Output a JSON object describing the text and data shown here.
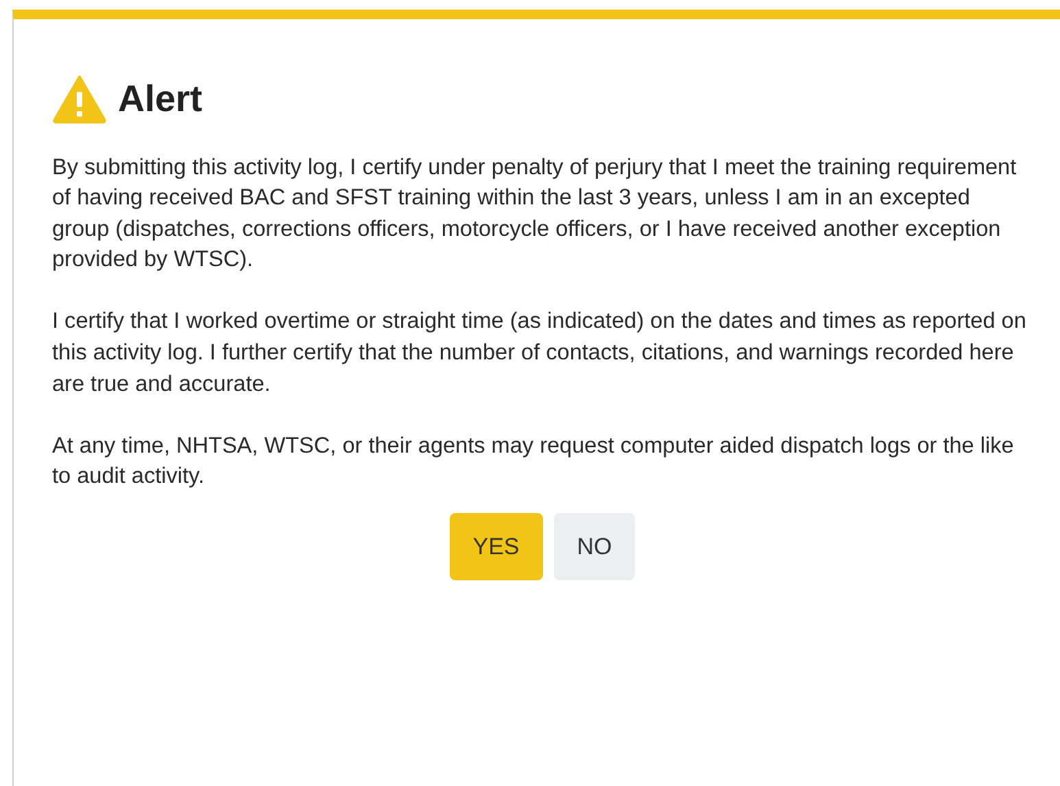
{
  "dialog": {
    "title": "Alert",
    "paragraphs": [
      "By submitting this activity log, I certify under penalty of perjury that I meet the training requirement of having received BAC and SFST training within the last 3 years, unless I am in an excepted group (dispatches, corrections officers, motorcycle officers, or I have received another exception provided by WTSC).",
      "I certify that I worked overtime or straight time (as indicated) on the dates and times as reported on this activity log. I further certify that the number of contacts, citations, and warnings recorded here are true and accurate.",
      "At any time, NHTSA, WTSC, or their agents may request computer aided dispatch logs or the like to audit activity."
    ],
    "buttons": [
      {
        "label": "YES",
        "kind": "primary"
      },
      {
        "label": "NO",
        "kind": "secondary"
      }
    ]
  }
}
